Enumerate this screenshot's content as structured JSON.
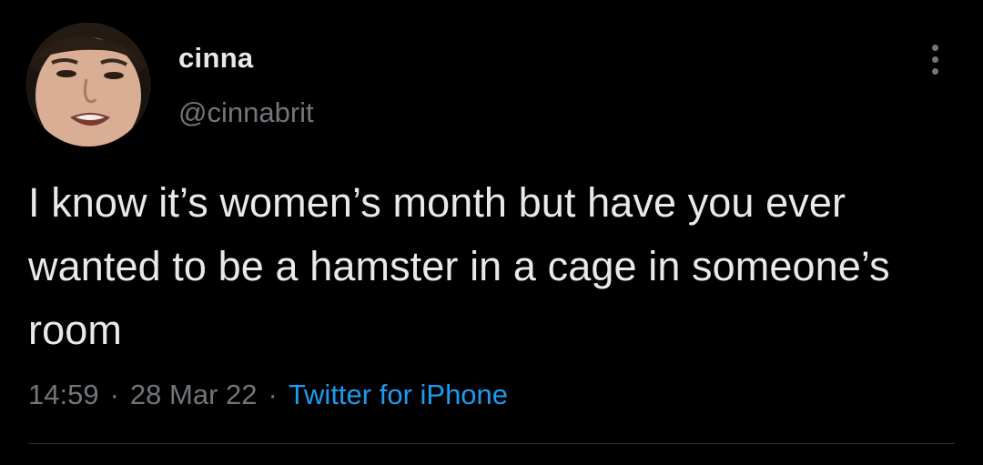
{
  "tweet": {
    "display_name": "cinna",
    "handle": "@cinnabrit",
    "text": "I know it’s women’s month but have you ever wanted to be a hamster in a cage in someone’s room",
    "time": "14:59",
    "separator": "·",
    "date": "28 Mar 22",
    "source": "Twitter for iPhone"
  },
  "icons": {
    "more": "more-vertical-icon",
    "avatar": "profile-photo"
  },
  "colors": {
    "background": "#000000",
    "primary_text": "#e7e9ea",
    "secondary_text": "#71767b",
    "link": "#1d9bf0",
    "divider": "#2f3336"
  }
}
